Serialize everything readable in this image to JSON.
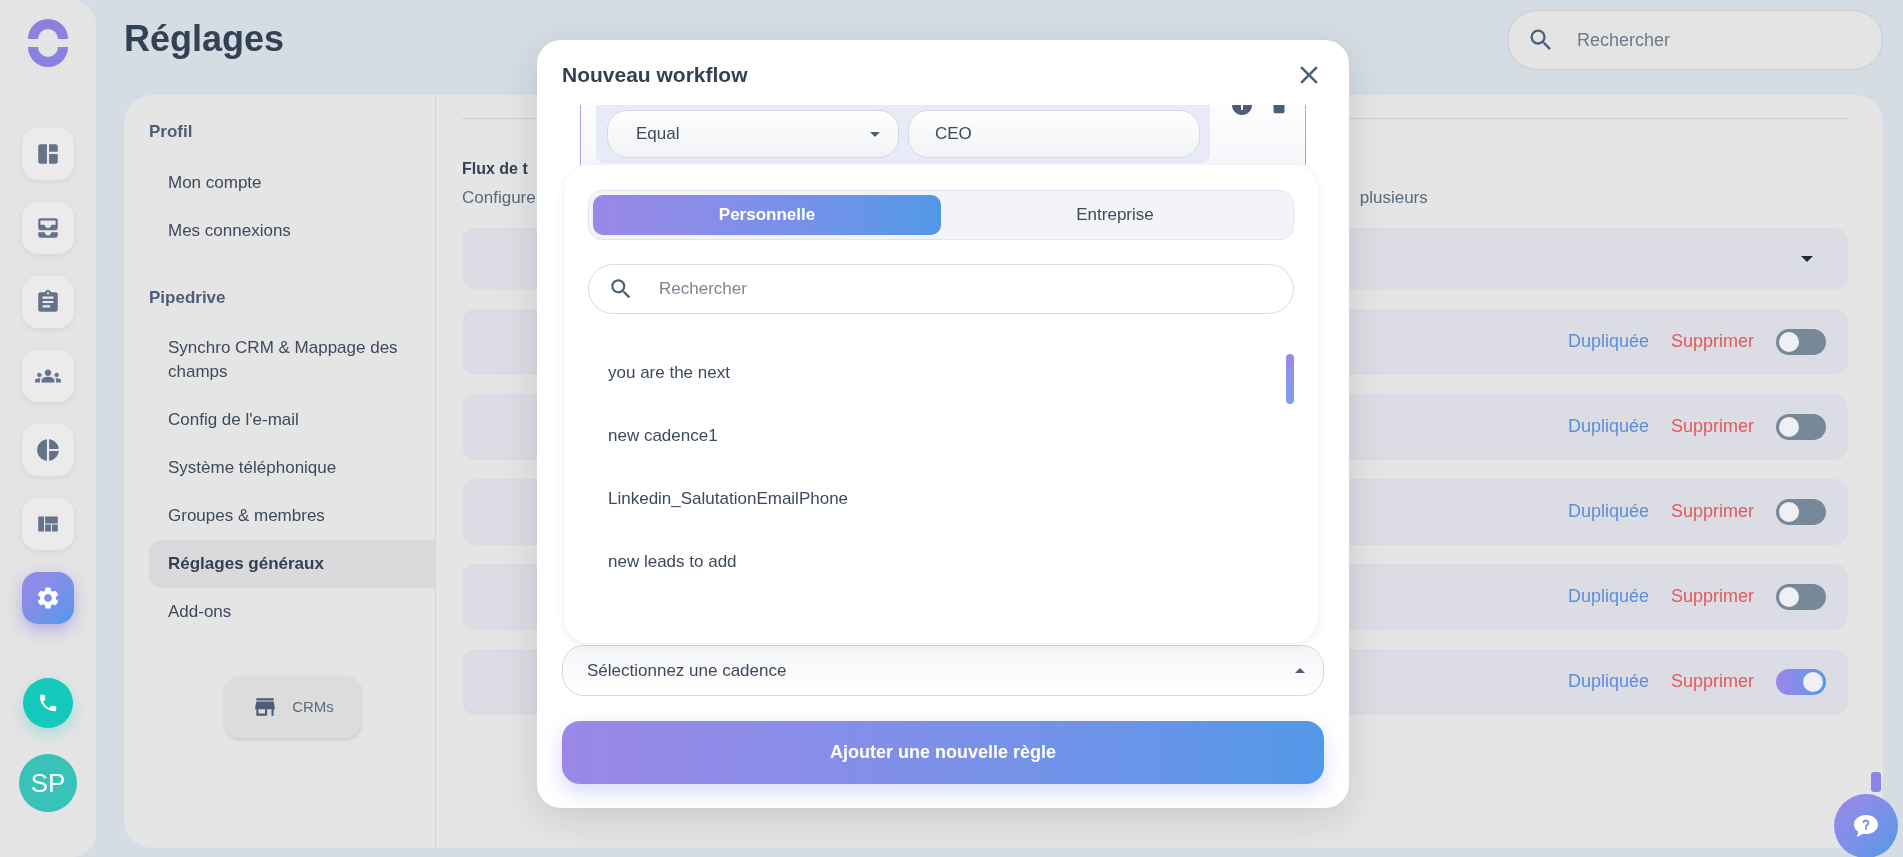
{
  "rail": {
    "items": [
      {
        "kind": "dashboard",
        "selected": false
      },
      {
        "kind": "tray",
        "selected": false
      },
      {
        "kind": "clipboard",
        "selected": false
      },
      {
        "kind": "people",
        "selected": false
      },
      {
        "kind": "pie",
        "selected": false
      },
      {
        "kind": "layout",
        "selected": false
      },
      {
        "kind": "gear",
        "selected": true
      }
    ],
    "avatar": "SP"
  },
  "page_title": "Réglages",
  "search": {
    "placeholder": "Rechercher"
  },
  "settings_nav": {
    "sections": [
      {
        "title": "Profil",
        "items": [
          {
            "label": "Mon compte",
            "selected": false
          },
          {
            "label": "Mes connexions",
            "selected": false
          }
        ]
      },
      {
        "title": "Pipedrive",
        "items": [
          {
            "label": "Synchro CRM & Mappage des champs",
            "selected": false
          },
          {
            "label": "Config de l'e-mail",
            "selected": false
          },
          {
            "label": "Système téléphonique",
            "selected": false
          },
          {
            "label": "Groupes & membres",
            "selected": false
          },
          {
            "label": "Réglages généraux",
            "selected": true
          },
          {
            "label": "Add-ons",
            "selected": false
          }
        ]
      }
    ],
    "crms_button": "CRMs"
  },
  "content": {
    "heading": "Flux de t",
    "description": "Configure",
    "description_tail": "plusieurs",
    "workflows": [
      {
        "duplicate": "Dupliquée",
        "delete": "Supprimer",
        "on": false
      },
      {
        "duplicate": "Dupliquée",
        "delete": "Supprimer",
        "on": false
      },
      {
        "duplicate": "Dupliquée",
        "delete": "Supprimer",
        "on": false
      },
      {
        "duplicate": "Dupliquée",
        "delete": "Supprimer",
        "on": false
      },
      {
        "duplicate": "Dupliquée",
        "delete": "Supprimer",
        "on": true
      }
    ]
  },
  "modal": {
    "title": "Nouveau workflow",
    "condition": {
      "operator": "Equal",
      "value": "CEO"
    },
    "picker": {
      "tabs": [
        {
          "label": "Personnelle",
          "selected": true
        },
        {
          "label": "Entreprise",
          "selected": false
        }
      ],
      "search": {
        "placeholder": "Rechercher"
      },
      "options": [
        "you are the next",
        "new cadence1",
        "Linkedin_SalutationEmailPhone",
        "new leads to add"
      ]
    },
    "cadence_select": {
      "placeholder": "Sélectionnez une cadence",
      "expanded": true
    },
    "add_button": "Ajouter une nouvelle règle"
  }
}
